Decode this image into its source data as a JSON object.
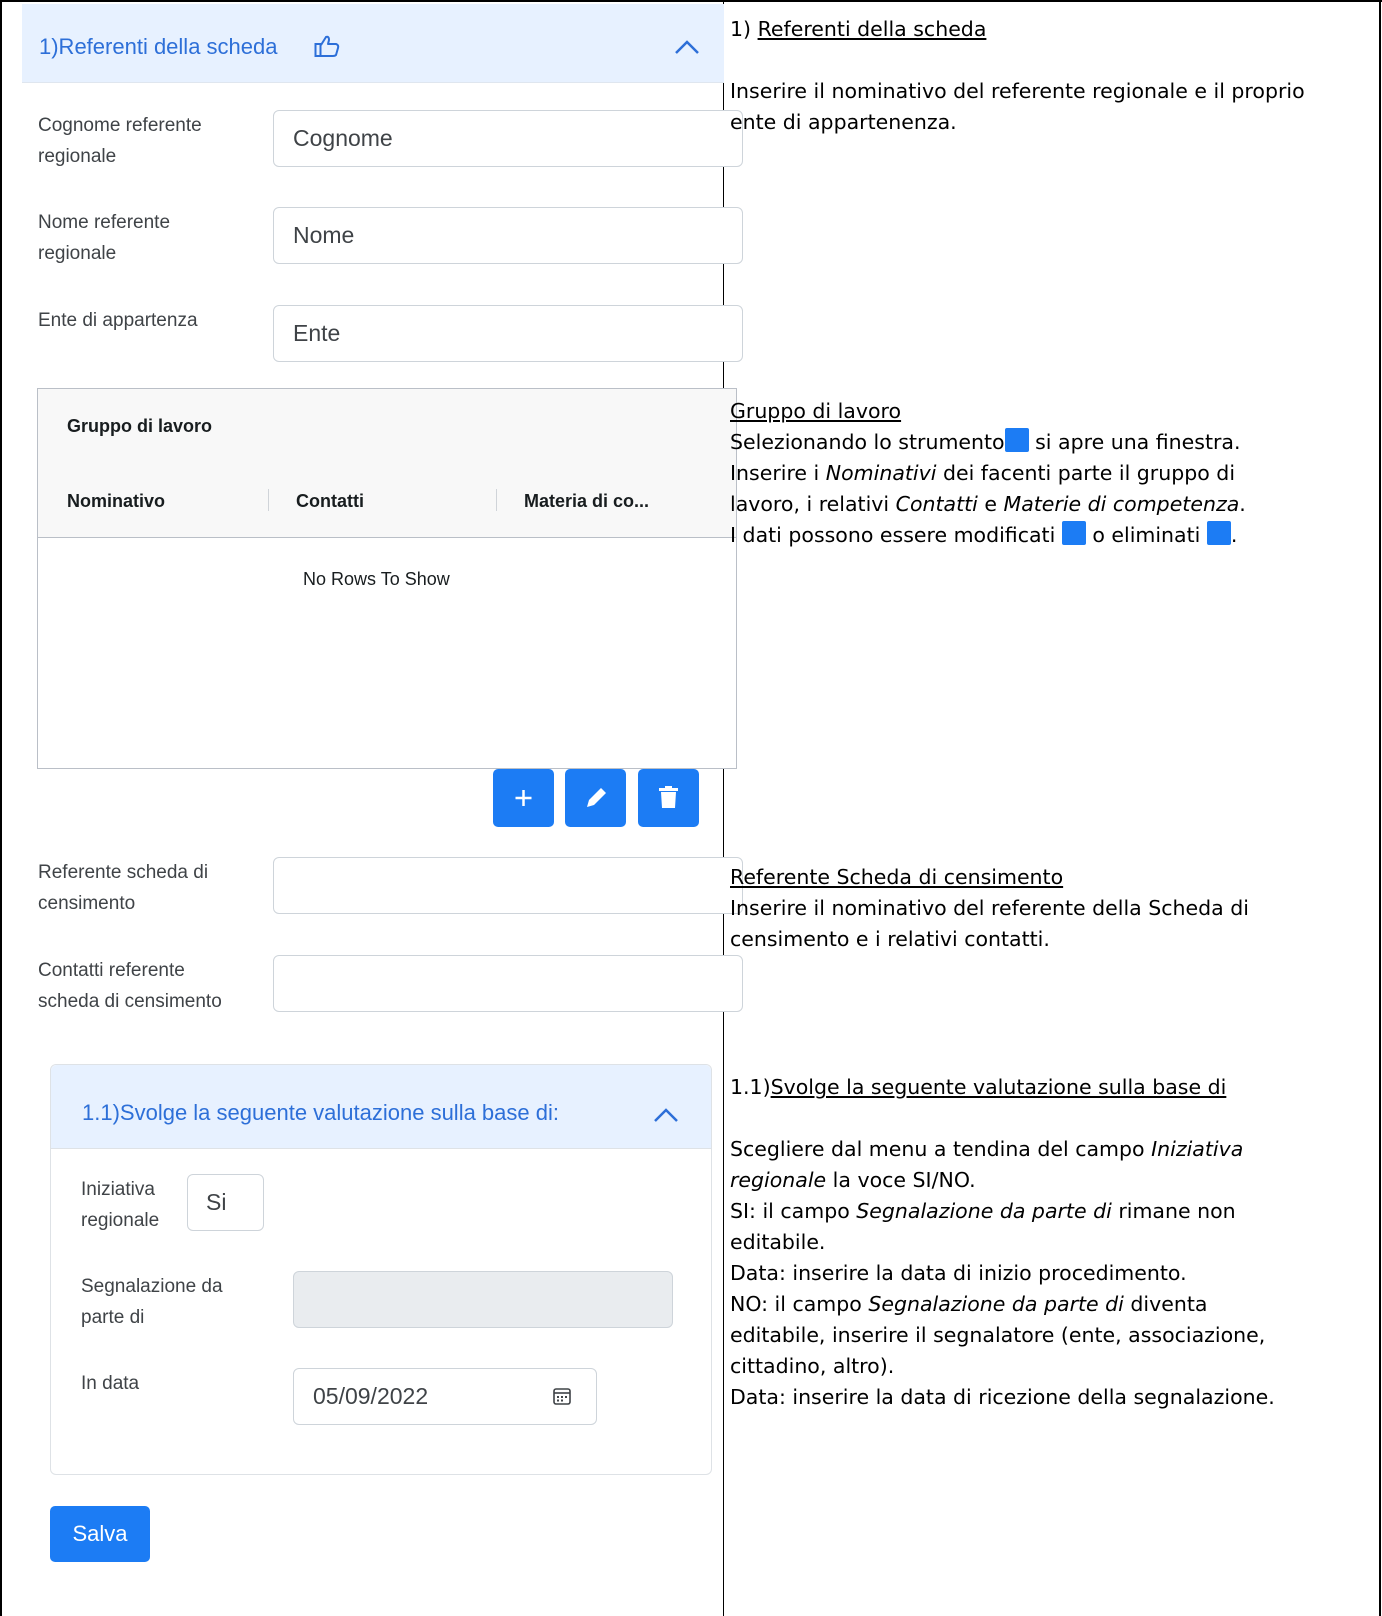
{
  "left_panel": {
    "section_title": "1)Referenti della scheda",
    "fields": {
      "cognome_label": "Cognome referente regionale",
      "cognome_value": "Cognome",
      "nome_label": "Nome referente regionale",
      "nome_value": "Nome",
      "ente_label": "Ente di appartenza",
      "ente_value": "Ente",
      "ref_scheda_label": "Referente scheda di censimento",
      "ref_scheda_value": "",
      "contatti_label": "Contatti referente scheda di censimento",
      "contatti_value": ""
    },
    "grid": {
      "title": "Gruppo di lavoro",
      "columns": [
        "Nominativo",
        "Contatti",
        "Materia di co..."
      ],
      "empty_text": "No Rows To Show"
    },
    "buttons": {
      "add_icon": "plus-icon",
      "edit_icon": "pencil-icon",
      "delete_icon": "trash-icon"
    },
    "subsection": {
      "title": "1.1)Svolge la seguente valutazione sulla base di:",
      "iniziativa_label": "Iniziativa regionale",
      "iniziativa_value": "Si",
      "segnalazione_label": "Segnalazione da parte di",
      "segnalazione_value": "",
      "data_label": "In data",
      "data_value": "05/09/2022"
    },
    "save_label": "Salva",
    "colors": {
      "primary": "#1c7cf4",
      "header_bg": "#e7f1ff",
      "title_blue": "#2d6fd8"
    }
  },
  "right_panel": {
    "s1_number": "1) ",
    "s1_heading": "Referenti della scheda",
    "s1_text": "Inserire il nominativo del referente regionale e il proprio ente di appartenenza.",
    "s2_heading": "Gruppo di lavoro",
    "s2_l1a": "Selezionando lo strumento",
    "s2_l1b": " si apre una finestra.",
    "s2_l2a": "Inserire i ",
    "s2_l2b": "Nominativi",
    "s2_l2c": " dei facenti parte il gruppo di",
    "s2_l3a": "lavoro, i relativi ",
    "s2_l3b": "Contatti",
    "s2_l3c": " e ",
    "s2_l3d": "Materie di competenza",
    "s2_l3e": ".",
    "s2_l4a": "I dati possono essere modificati ",
    "s2_l4b": " o eliminati ",
    "s2_l4c": ".",
    "s3_heading": "Referente Scheda di censimento",
    "s3_text": "Inserire il nominativo del referente della Scheda di censimento e i relativi contatti.",
    "s4_number": "1.1)",
    "s4_heading": "Svolge la seguente valutazione sulla base di",
    "s4_l1a": "Scegliere dal menu a tendina del campo ",
    "s4_l1b": "Iniziativa",
    "s4_l2a": "regionale",
    "s4_l2b": " la voce SI/NO.",
    "s4_l3a": "SI: il campo ",
    "s4_l3b": "Segnalazione da parte di",
    "s4_l3c": " rimane non",
    "s4_l4": "editabile.",
    "s4_l5": "Data: inserire la data di inizio procedimento.",
    "s4_l6a": "NO: il campo ",
    "s4_l6b": "Segnalazione da parte di",
    "s4_l6c": " diventa",
    "s4_l7": "editabile, inserire il segnalatore (ente, associazione,",
    "s4_l8": "cittadino, altro).",
    "s4_l9": "Data: inserire la data di ricezione della segnalazione."
  }
}
